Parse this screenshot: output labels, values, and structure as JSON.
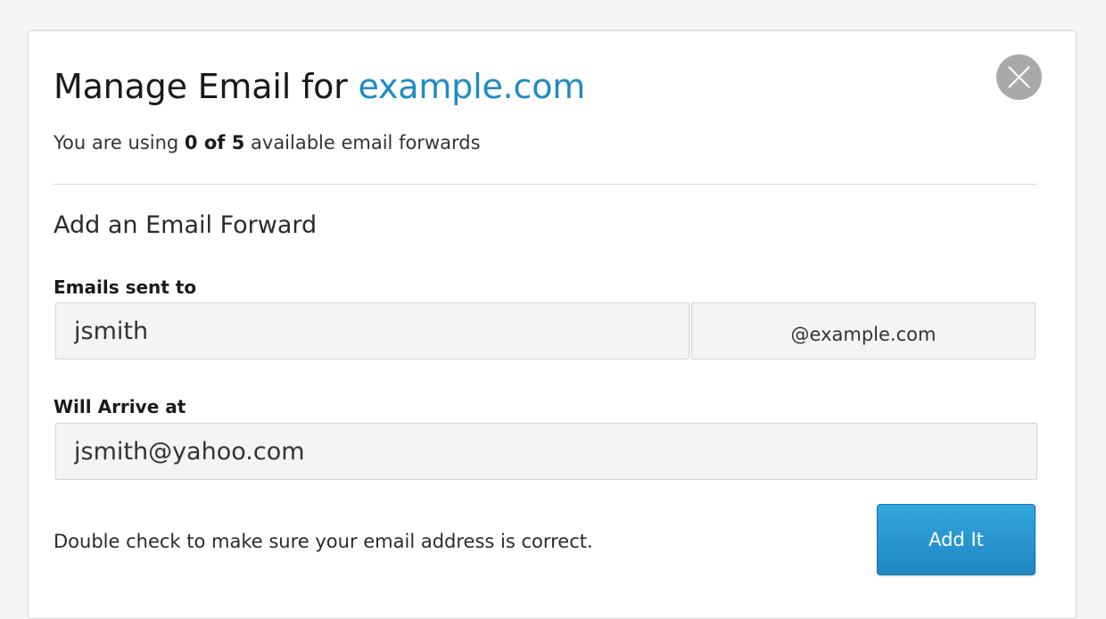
{
  "modal": {
    "title_prefix": "Manage Email for ",
    "title_domain": "example.com",
    "usage_prefix": "You are using ",
    "usage_count": "0 of 5",
    "usage_suffix": " available email forwards",
    "close_icon": "close-icon"
  },
  "form": {
    "section_title": "Add an Email Forward",
    "sent_to_label": "Emails sent to",
    "local_part_value": "jsmith",
    "domain_suffix": "@example.com",
    "arrive_label": "Will Arrive at",
    "arrive_value": "jsmith@yahoo.com",
    "hint": "Double check to make sure your email address is correct.",
    "submit_label": "Add It"
  },
  "colors": {
    "accent": "#1e8bc3",
    "button": "#2a99d2",
    "close_button": "#a9a9a9"
  }
}
